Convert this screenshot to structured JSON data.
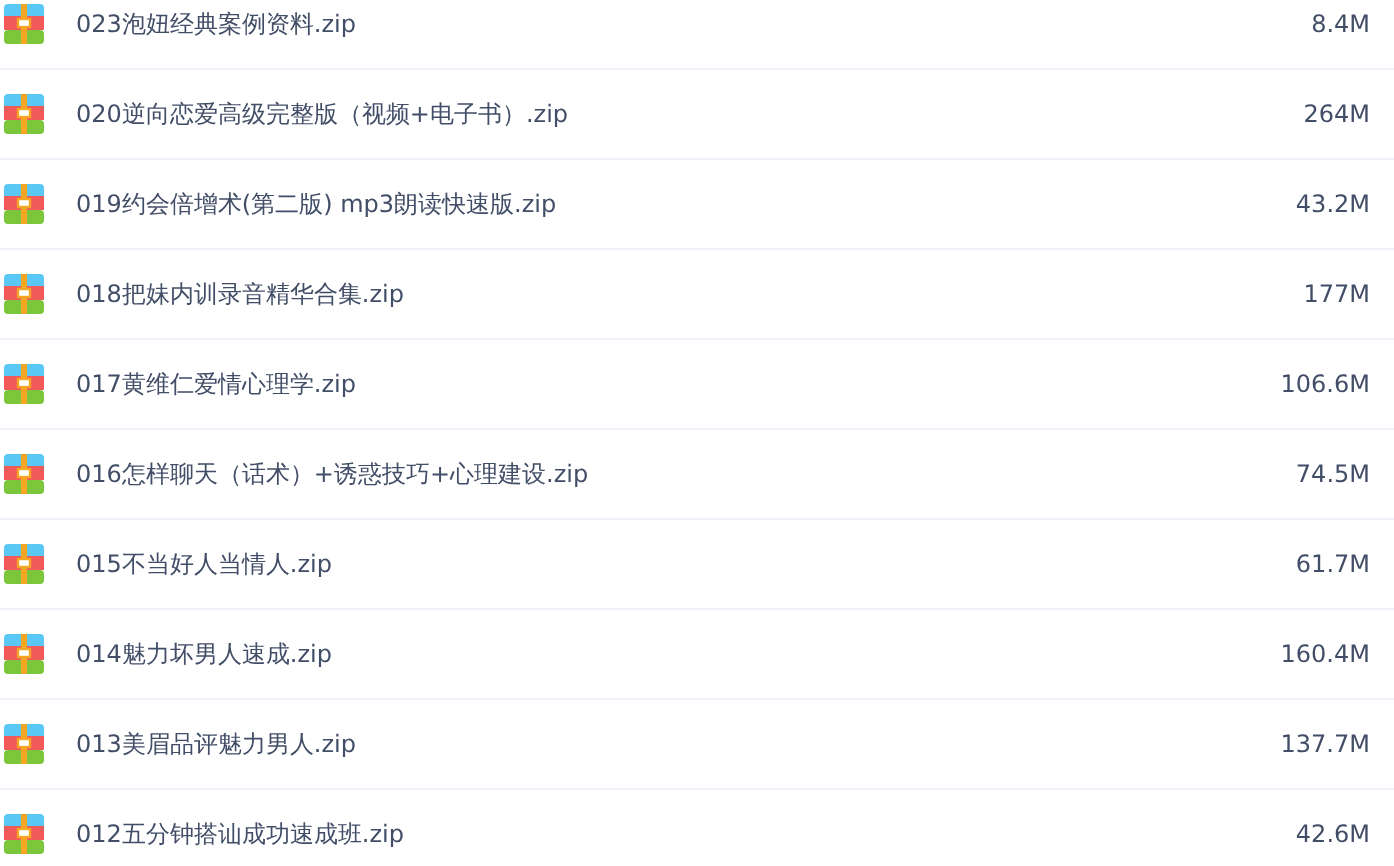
{
  "files": [
    {
      "name": "023泡妞经典案例资料.zip",
      "size": "8.4M"
    },
    {
      "name": "020逆向恋爱高级完整版（视频+电子书）.zip",
      "size": "264M"
    },
    {
      "name": "019约会倍增术(第二版) mp3朗读快速版.zip",
      "size": "43.2M"
    },
    {
      "name": "018把妹内训录音精华合集.zip",
      "size": "177M"
    },
    {
      "name": "017黄维仁爱情心理学.zip",
      "size": "106.6M"
    },
    {
      "name": "016怎样聊天（话术）+诱惑技巧+心理建设.zip",
      "size": "74.5M"
    },
    {
      "name": "015不当好人当情人.zip",
      "size": "61.7M"
    },
    {
      "name": "014魅力坏男人速成.zip",
      "size": "160.4M"
    },
    {
      "name": "013美眉品评魅力男人.zip",
      "size": "137.7M"
    },
    {
      "name": "012五分钟搭讪成功速成班.zip",
      "size": "42.6M"
    }
  ]
}
